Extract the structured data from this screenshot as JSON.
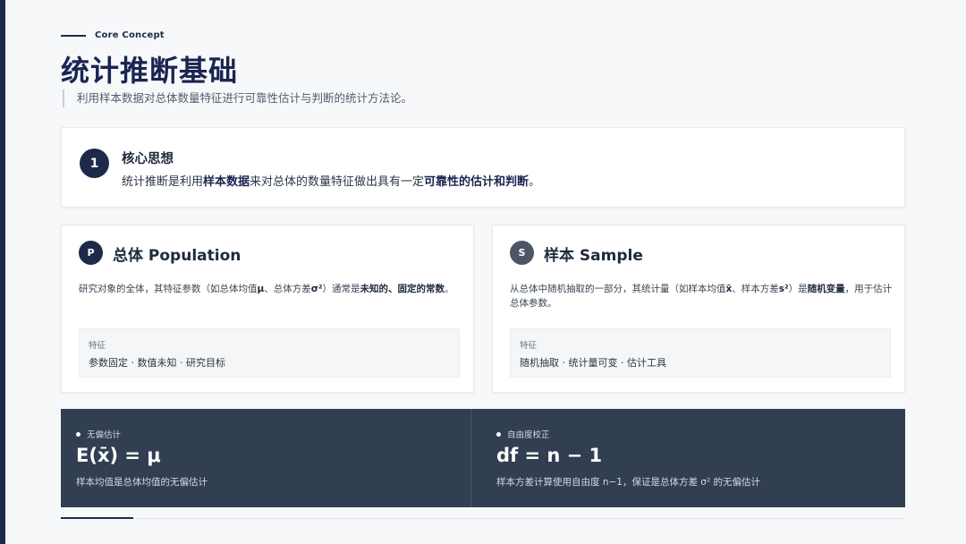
{
  "header": {
    "eyebrow": "Core Concept",
    "title": "统计推断基础",
    "subtitle": "利用样本数据对总体数量特征进行可靠性估计与判断的统计方法论。"
  },
  "core": {
    "number": "1",
    "title": "核心思想",
    "text_part1": "统计推断是利用",
    "text_bold1": "样本数据",
    "text_part2": "来对总体的数量特征做出具有一定",
    "text_bold2": "可靠性的估计和判断",
    "text_part3": "。"
  },
  "population": {
    "icon_letter": "P",
    "title": "总体 Population",
    "desc_part1": "研究对象的全体，其特征参数（如总体均值",
    "desc_bold1": "μ",
    "desc_part2": "、总体方差",
    "desc_bold2": "σ²",
    "desc_part3": "）通常是",
    "desc_bold3": "未知的、固定的常数",
    "desc_part4": "。",
    "feature_label": "特征",
    "feature_value": "参数固定 · 数值未知 · 研究目标"
  },
  "sample": {
    "icon_letter": "S",
    "title": "样本 Sample",
    "desc_part1": "从总体中随机抽取的一部分，其统计量（如样本均值",
    "desc_bold1": "x̄",
    "desc_part2": "、样本方差",
    "desc_bold2": "s²",
    "desc_part3": "）是",
    "desc_bold3": "随机变量",
    "desc_part4": "，用于估计总体参数。",
    "feature_label": "特征",
    "feature_value": "随机抽取 · 统计量可变 · 估计工具"
  },
  "formulas": {
    "left": {
      "tag": "无偏估计",
      "formula": "E(x̄) = μ",
      "note": "样本均值是总体均值的无偏估计"
    },
    "right": {
      "tag": "自由度校正",
      "formula": "df = n − 1",
      "note": "样本方差计算使用自由度 n−1，保证是总体方差 σ² 的无偏估计"
    }
  },
  "colors": {
    "navy": "#1e2a4a",
    "slate": "#323e52",
    "sample_badge": "#4c5566"
  }
}
